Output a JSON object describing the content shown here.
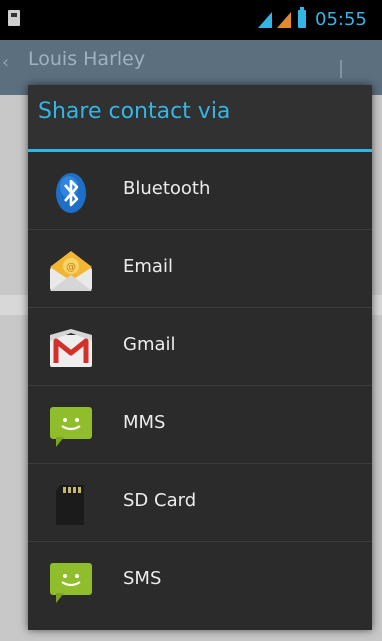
{
  "status_bar": {
    "time": "05:55"
  },
  "background_app": {
    "title": "Louis Harley"
  },
  "dialog": {
    "title": "Share contact via",
    "options": [
      {
        "label": "Bluetooth",
        "icon": "bluetooth-icon"
      },
      {
        "label": "Email",
        "icon": "email-icon"
      },
      {
        "label": "Gmail",
        "icon": "gmail-icon"
      },
      {
        "label": "MMS",
        "icon": "mms-icon"
      },
      {
        "label": "SD Card",
        "icon": "sd-card-icon"
      },
      {
        "label": "SMS",
        "icon": "sms-icon"
      }
    ]
  },
  "colors": {
    "accent": "#33b5e5",
    "dialog_bg": "#2b2b2b",
    "status_bg": "#000000"
  }
}
